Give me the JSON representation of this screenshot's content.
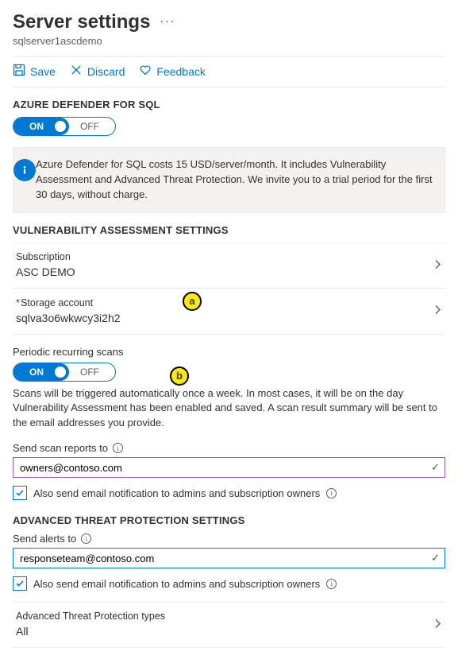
{
  "header": {
    "title": "Server settings",
    "more": "···",
    "subtitle": "sqlserver1ascdemo"
  },
  "toolbar": {
    "save": "Save",
    "discard": "Discard",
    "feedback": "Feedback"
  },
  "sections": {
    "defender": "AZURE DEFENDER FOR SQL",
    "vuln": "VULNERABILITY ASSESSMENT SETTINGS",
    "atp": "ADVANCED THREAT PROTECTION SETTINGS"
  },
  "toggle": {
    "on": "ON",
    "off": "OFF"
  },
  "infobox": {
    "text": "Azure Defender for SQL costs 15 USD/server/month. It includes Vulnerability Assessment and Advanced Threat Protection. We invite you to a trial period for the first 30 days, without charge."
  },
  "vuln": {
    "subscription_label": "Subscription",
    "subscription_value": "ASC DEMO",
    "storage_label": "Storage account",
    "storage_value": "sqlva3o6wkwcy3i2h2",
    "periodic_label": "Periodic recurring scans",
    "periodic_help": "Scans will be triggered automatically once a week. In most cases, it will be on the day Vulnerability Assessment has been enabled and saved. A scan result summary will be sent to the email addresses you provide.",
    "send_reports_label": "Send scan reports to",
    "send_reports_value": "owners@contoso.com",
    "also_notify": "Also send email notification to admins and subscription owners"
  },
  "atp": {
    "send_alerts_label": "Send alerts to",
    "send_alerts_value": "responseteam@contoso.com",
    "also_notify": "Also send email notification to admins and subscription owners",
    "types_label": "Advanced Threat Protection types",
    "types_value": "All"
  },
  "annotations": {
    "a": "a",
    "b": "b"
  }
}
